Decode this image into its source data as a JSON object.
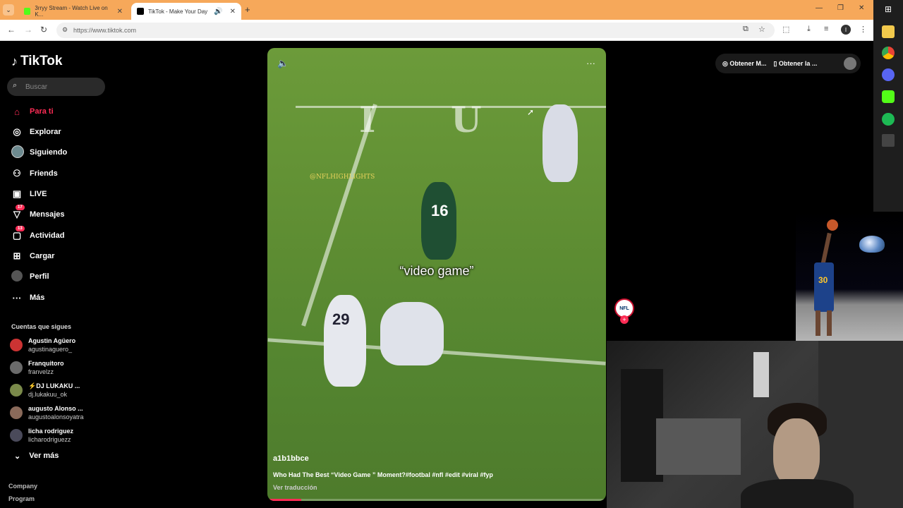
{
  "browser": {
    "tabs": [
      {
        "title": "3rryy Stream - Watch Live on K...",
        "active": false,
        "favicon_color": "#53fc18"
      },
      {
        "title": "TikTok - Make Your Day",
        "active": true,
        "favicon_color": "#000000"
      }
    ],
    "url": "https://www.tiktok.com",
    "profile_initial": "I",
    "tab_bar_color": "#f6a85a"
  },
  "sidebar": {
    "logo_text": "TikTok",
    "search_placeholder": "Buscar",
    "nav": [
      {
        "label": "Para ti",
        "icon": "home-icon",
        "active": true
      },
      {
        "label": "Explorar",
        "icon": "compass-icon"
      },
      {
        "label": "Siguiendo",
        "icon": "following-avatar-icon"
      },
      {
        "label": "Friends",
        "icon": "friends-icon"
      },
      {
        "label": "LIVE",
        "icon": "live-icon"
      },
      {
        "label": "Mensajes",
        "icon": "messages-icon",
        "badge": "17"
      },
      {
        "label": "Actividad",
        "icon": "activity-icon",
        "badge": "13"
      },
      {
        "label": "Cargar",
        "icon": "upload-icon"
      },
      {
        "label": "Perfil",
        "icon": "profile-icon"
      },
      {
        "label": "Más",
        "icon": "more-icon"
      }
    ],
    "following_title": "Cuentas que sigues",
    "following": [
      {
        "name": "Agustin Agüero",
        "handle": "agustinaguero_"
      },
      {
        "name": "Franquitoro",
        "handle": "franvelzz"
      },
      {
        "name": "⚡DJ LUKAKU ...",
        "handle": "dj.lukakuu_ok"
      },
      {
        "name": "augusto Alonso ...",
        "handle": "augustoalonsoyatra"
      },
      {
        "name": "licha rodriguez",
        "handle": "licharodriguezz"
      }
    ],
    "see_more": "Ver más",
    "footer": [
      "Company",
      "Program"
    ]
  },
  "video": {
    "watermark": "@NFLHIGHLIGHTS",
    "overlay_caption": "“video game”",
    "author": "a1b1bbce",
    "description": "Who Had The Best “Video Game ” Moment?#footbal #nfl #edit #viral #fyp",
    "translate": "Ver traducción",
    "jersey_numbers": [
      "16",
      "29"
    ],
    "progress_fraction": 0.1,
    "accent": "#fe2c55"
  },
  "top_actions": {
    "get_coins": "Obtener M...",
    "get_app": "Obtener la ..."
  },
  "creator_avatar_text": "NFL",
  "stream_overlay": {
    "jersey": "30"
  }
}
